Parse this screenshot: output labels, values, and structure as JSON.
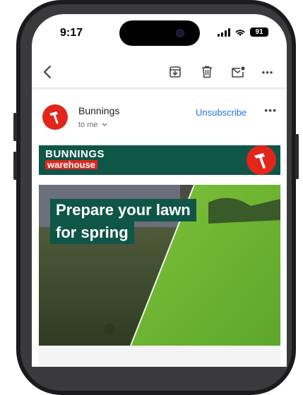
{
  "status_bar": {
    "time": "9:17",
    "battery": "91"
  },
  "toolbar": {
    "back_icon": "chevron-left-icon",
    "archive_icon": "archive-icon",
    "delete_icon": "trash-icon",
    "mark_unread_icon": "mail-unread-icon",
    "more_icon": "more-horizontal-icon",
    "more_label": "•••"
  },
  "message": {
    "sender": "Bunnings",
    "recipient": "to me",
    "unsubscribe_label": "Unsubscribe",
    "more_label": "•••"
  },
  "banner": {
    "logo_top": "BUNNINGS",
    "logo_bottom": "warehouse",
    "accent": "#0f5548",
    "brand_red": "#e1261c"
  },
  "hero": {
    "headline_line1": "Prepare your lawn",
    "headline_line2": "for spring"
  }
}
